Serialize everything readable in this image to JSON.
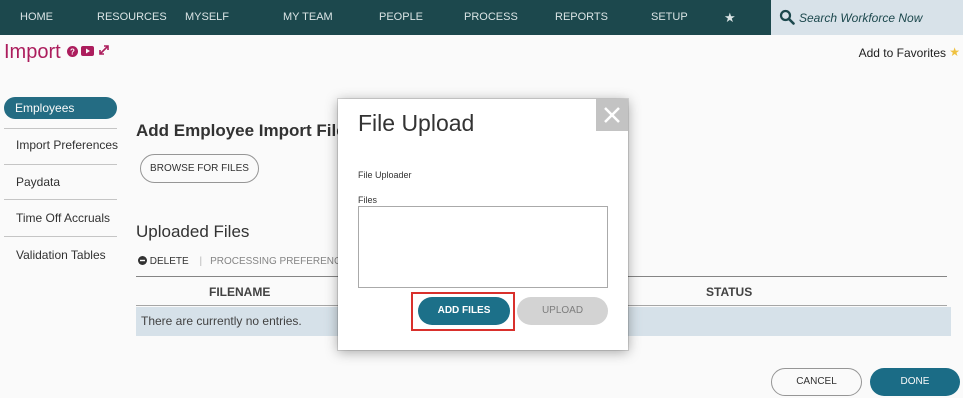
{
  "nav": {
    "items": [
      "HOME",
      "RESOURCES",
      "MYSELF",
      "MY TEAM",
      "PEOPLE",
      "PROCESS",
      "REPORTS",
      "SETUP"
    ],
    "star_icon": "star-icon",
    "search_placeholder": "Search Workforce Now",
    "bg_color": "#1d4a4f"
  },
  "header": {
    "title": "Import",
    "icons": [
      "help-icon",
      "video-icon",
      "expand-icon"
    ],
    "add_favorites": "Add to Favorites",
    "title_color": "#b01e5f"
  },
  "sidebar": {
    "items": [
      {
        "label": "Employees",
        "active": true
      },
      {
        "label": "Import Preferences"
      },
      {
        "label": "Paydata"
      },
      {
        "label": "Time Off Accruals"
      },
      {
        "label": "Validation Tables"
      }
    ]
  },
  "main": {
    "heading": "Add Employee Import File",
    "browse_label": "BROWSE FOR FILES",
    "uploaded_heading": "Uploaded Files",
    "toolbar": {
      "delete_label": "DELETE",
      "processing_label": "PROCESSING PREFERENCES"
    },
    "table": {
      "columns": [
        "FILENAME",
        "STATUS"
      ],
      "empty_text": "There are currently no entries."
    },
    "cancel_label": "CANCEL",
    "done_label": "DONE"
  },
  "dialog": {
    "title": "File Upload",
    "subtitle": "File Uploader",
    "files_label": "Files",
    "add_files_label": "ADD FILES",
    "upload_label": "UPLOAD",
    "accent_color": "#1c7089"
  }
}
